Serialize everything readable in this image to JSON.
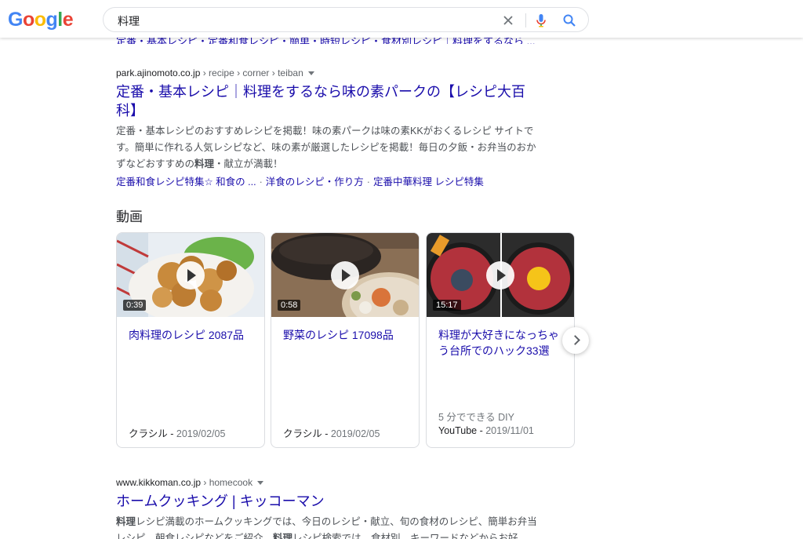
{
  "header": {
    "logo_letters": [
      {
        "ch": "G",
        "color": "#4285F4"
      },
      {
        "ch": "o",
        "color": "#EA4335"
      },
      {
        "ch": "o",
        "color": "#FBBC05"
      },
      {
        "ch": "g",
        "color": "#4285F4"
      },
      {
        "ch": "l",
        "color": "#34A853"
      },
      {
        "ch": "e",
        "color": "#EA4335"
      }
    ],
    "query": "料理",
    "icons": {
      "clear": "close-icon",
      "mic": "mic-icon",
      "search": "search-icon"
    }
  },
  "cut_snippet": "定番・基本レシピ・定番和食レシピ・簡単・時短レシピ・食材別レシピ｜料理をするなら ...",
  "result1": {
    "domain": "park.ajinomoto.co.jp",
    "path": " › recipe › corner › teiban",
    "title": "定番・基本レシピ｜料理をするなら味の素パークの【レシピ大百科】",
    "snippet_parts": [
      {
        "text": "定番・基本レシピのおすすめレシピを掲載！味の素パークは味の素KKがおくるレシピ サイトです。簡単に作れる人気レシピなど、味の素が厳選したレシピを掲載！毎日の夕飯・お弁当のおかずなどおすすめの",
        "bold": false
      },
      {
        "text": "料理",
        "bold": true
      },
      {
        "text": "・献立が満載！",
        "bold": false
      }
    ],
    "sitelinks": [
      "定番和食レシピ特集☆ 和食の ...",
      "洋食のレシピ・作り方",
      "定番中華料理 レシピ特集"
    ]
  },
  "videos_heading": "動画",
  "videos": [
    {
      "title": "肉料理のレシピ 2087品",
      "duration": "0:39",
      "subtitle": "",
      "source": "クラシル",
      "date": "2019/02/05"
    },
    {
      "title": "野菜のレシピ 17098品",
      "duration": "0:58",
      "subtitle": "",
      "source": "クラシル",
      "date": "2019/02/05"
    },
    {
      "title": "料理が大好きになっちゃう台所でのハック33選",
      "duration": "15:17",
      "subtitle": "5 分でできる DIY",
      "source": "YouTube",
      "date": "2019/11/01"
    }
  ],
  "result2": {
    "domain": "www.kikkoman.co.jp",
    "path": " › homecook",
    "title": "ホームクッキング | キッコーマン",
    "snippet_parts": [
      {
        "text": "料理",
        "bold": true
      },
      {
        "text": "レシピ満載のホームクッキングでは、今日のレシピ・献立、旬の食材のレシピ、簡単お弁当レシピ、朝食レシピなどをご紹介。",
        "bold": false
      },
      {
        "text": "料理",
        "bold": true
      },
      {
        "text": "レシピ検索では、食材別、キーワードなどからお好",
        "bold": false
      }
    ]
  }
}
